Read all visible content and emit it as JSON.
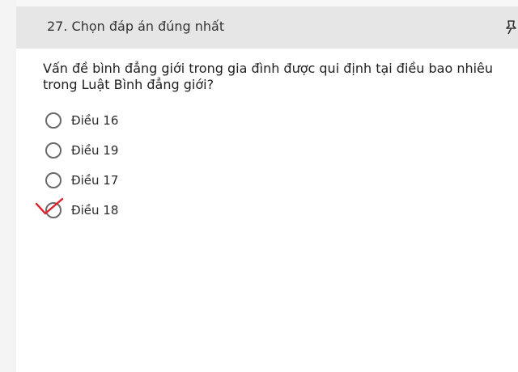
{
  "header": {
    "title": "27. Chọn đáp án đúng nhất",
    "pin_icon": "pin-icon"
  },
  "question": {
    "text": "Vấn đề bình đẳng giới trong gia đình được qui định tại điều bao nhiêu trong Luật Bình đẳng giới?"
  },
  "options": [
    {
      "label": "Điều 16",
      "selected": false
    },
    {
      "label": "Điều 19",
      "selected": false
    },
    {
      "label": "Điều 17",
      "selected": false
    },
    {
      "label": "Điều 18",
      "selected": true
    }
  ],
  "colors": {
    "header_bg": "#e6e6e6",
    "check": "#e0202a",
    "radio_border": "#6a6a6a"
  }
}
